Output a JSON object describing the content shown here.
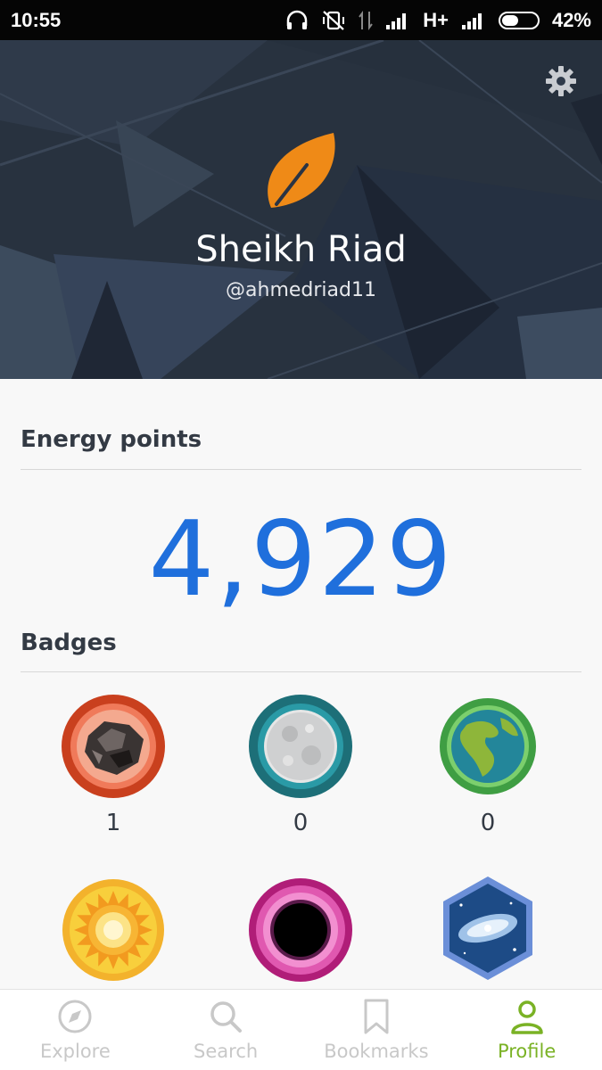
{
  "status_bar": {
    "time": "10:55",
    "network": "H+",
    "battery_percent": "42%",
    "battery_level": 0.42
  },
  "profile": {
    "name": "Sheikh Riad",
    "username": "@ahmedriad11",
    "avatar_icon": "leaf-icon",
    "avatar_color": "#ef8a17"
  },
  "energy": {
    "title": "Energy points",
    "value": "4,929",
    "color": "#1f6fdc"
  },
  "badges": {
    "title": "Badges",
    "items": [
      {
        "icon": "meteorite-badge-icon",
        "count": "1"
      },
      {
        "icon": "moon-badge-icon",
        "count": "0"
      },
      {
        "icon": "earth-badge-icon",
        "count": "0"
      },
      {
        "icon": "sun-badge-icon",
        "count": ""
      },
      {
        "icon": "black-hole-badge-icon",
        "count": ""
      },
      {
        "icon": "galaxy-badge-icon",
        "count": ""
      }
    ]
  },
  "tabs": [
    {
      "label": "Explore",
      "icon": "compass-icon",
      "active": false
    },
    {
      "label": "Search",
      "icon": "search-icon",
      "active": false
    },
    {
      "label": "Bookmarks",
      "icon": "bookmark-icon",
      "active": false
    },
    {
      "label": "Profile",
      "icon": "profile-icon",
      "active": true
    }
  ],
  "colors": {
    "active_tab": "#7ab225",
    "inactive_tab": "#c8c8c8",
    "header_bg": "#2a3444"
  }
}
